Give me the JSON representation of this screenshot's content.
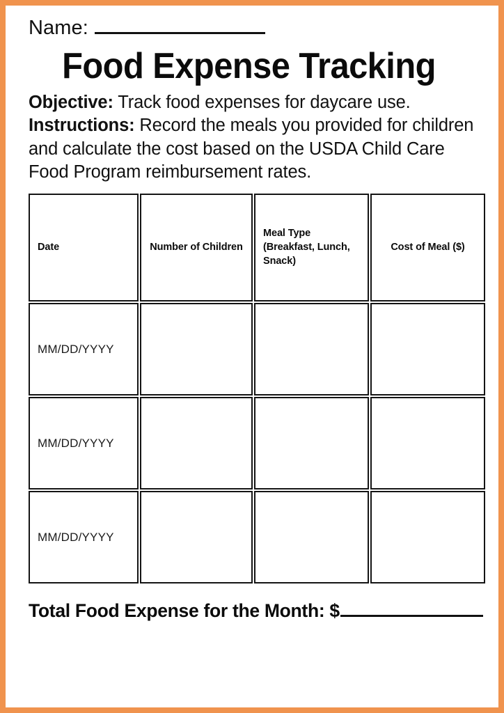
{
  "theme": {
    "border_color": "#f0934e",
    "text_color": "#111111",
    "cell_border_color": "#141414"
  },
  "header": {
    "name_label": "Name:",
    "name_value": "",
    "title": "Food Expense Tracking"
  },
  "intro": {
    "objective_label": "Objective:",
    "objective_text": " Track food expenses for daycare use.",
    "instructions_label": "Instructions:",
    "instructions_text": " Record the meals you provided for children and calculate the cost based on the USDA Child Care Food Program reimbursement rates."
  },
  "table": {
    "columns": [
      {
        "label": "Date",
        "align": "left"
      },
      {
        "label": "Number of Children",
        "align": "center"
      },
      {
        "label": "Meal Type (Breakfast, Lunch, Snack)",
        "align": "left"
      },
      {
        "label": "Cost of Meal ($)",
        "align": "center"
      }
    ],
    "rows": [
      {
        "date": "MM/DD/YYYY",
        "number_of_children": "",
        "meal_type": "",
        "cost": ""
      },
      {
        "date": "MM/DD/YYYY",
        "number_of_children": "",
        "meal_type": "",
        "cost": ""
      },
      {
        "date": "MM/DD/YYYY",
        "number_of_children": "",
        "meal_type": "",
        "cost": ""
      }
    ]
  },
  "footer": {
    "total_label": "Total Food Expense for the Month: $",
    "total_value": ""
  }
}
